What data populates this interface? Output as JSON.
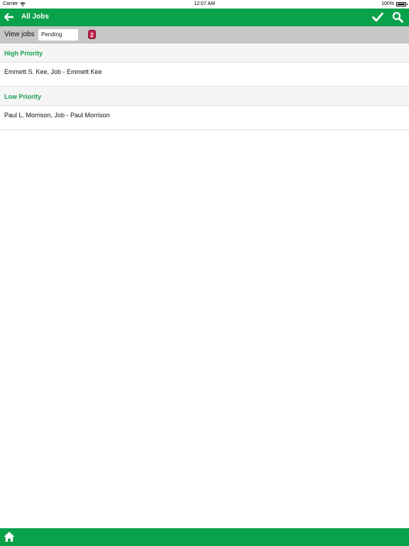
{
  "status_bar": {
    "carrier": "Carrier",
    "time": "12:07 AM",
    "battery": "100%",
    "battery_level": 1.0
  },
  "nav": {
    "title": "All Jobs",
    "back_icon": "back-arrow-icon",
    "confirm_icon": "checkmark-icon",
    "search_icon": "search-icon"
  },
  "filter": {
    "label": "View jobs",
    "selected": "Pending",
    "badge_count": "2"
  },
  "sections": [
    {
      "title": "High Priority",
      "items": [
        "Emmett S. Kee, Job - Emmett Kee"
      ]
    },
    {
      "title": "Low Priority",
      "items": [
        "Paul L. Morrison, Job - Paul Morrison"
      ]
    }
  ],
  "bottom_bar": {
    "home_icon": "home-icon"
  },
  "colors": {
    "brand_green": "#0aa14b",
    "section_text": "#1aa050",
    "badge_red": "#c4204a"
  }
}
